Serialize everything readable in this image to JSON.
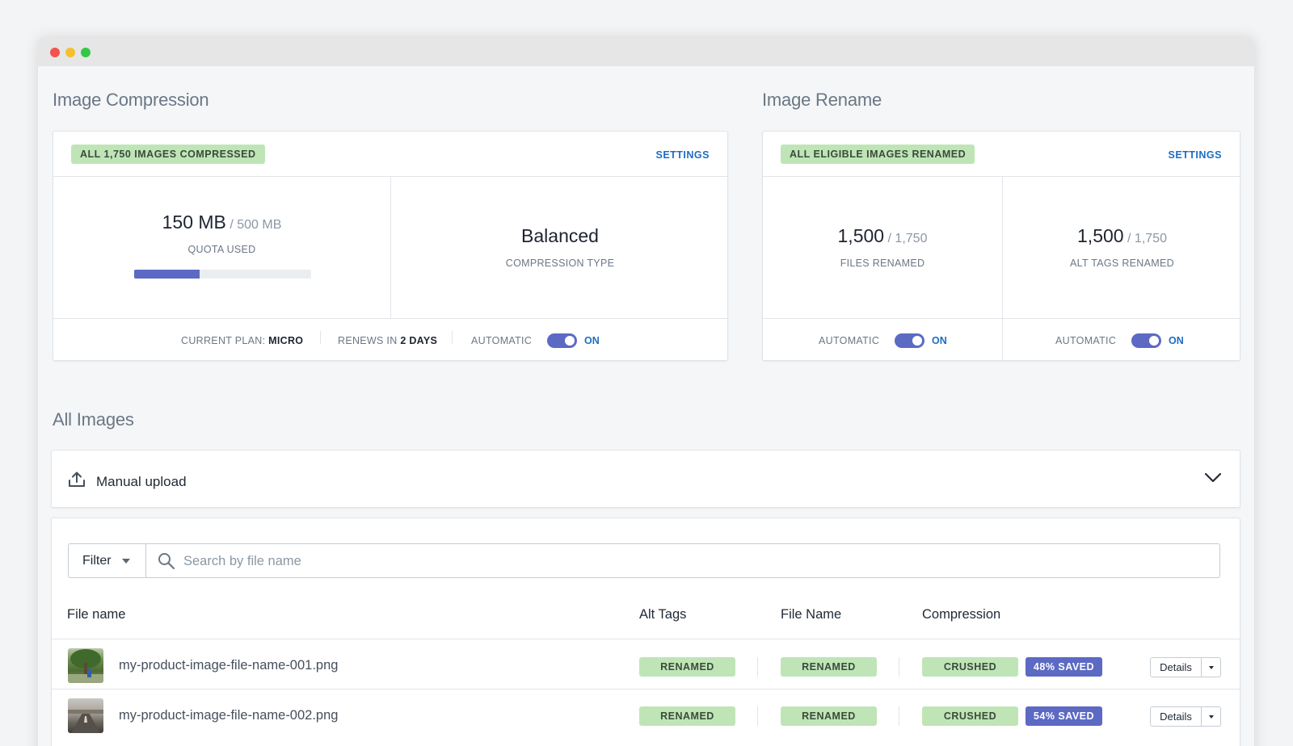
{
  "compression": {
    "section_title": "Image Compression",
    "status_badge": "ALL 1,750 IMAGES COMPRESSED",
    "settings_link": "SETTINGS",
    "quota_used": "150 MB",
    "quota_total": "/ 500 MB",
    "quota_label": "QUOTA USED",
    "quota_progress_percent": 37,
    "compression_type": "Balanced",
    "compression_type_label": "COMPRESSION TYPE",
    "plan_label": "CURRENT PLAN:",
    "plan_value": "MICRO",
    "renews_label": "RENEWS IN",
    "renews_value": "2 DAYS",
    "automatic_label": "AUTOMATIC",
    "automatic_state": "ON"
  },
  "rename": {
    "section_title": "Image Rename",
    "status_badge": "ALL ELIGIBLE IMAGES RENAMED",
    "settings_link": "SETTINGS",
    "files_renamed": "1,500",
    "files_total": "/ 1,750",
    "files_label": "FILES RENAMED",
    "alt_renamed": "1,500",
    "alt_total": "/ 1,750",
    "alt_label": "ALT TAGS RENAMED",
    "files_automatic_label": "AUTOMATIC",
    "files_automatic_state": "ON",
    "alt_automatic_label": "AUTOMATIC",
    "alt_automatic_state": "ON"
  },
  "all_images": {
    "section_title": "All Images",
    "upload_label": "Manual upload",
    "filter_label": "Filter",
    "search_placeholder": "Search by file name",
    "columns": {
      "file_name": "File name",
      "alt_tags": "Alt Tags",
      "file_name_status": "File Name",
      "compression": "Compression"
    },
    "rows": [
      {
        "file": "my-product-image-file-name-001.png",
        "alt_tags": "RENAMED",
        "file_name_status": "RENAMED",
        "compression": "CRUSHED",
        "saved": "48% SAVED",
        "details": "Details"
      },
      {
        "file": "my-product-image-file-name-002.png",
        "alt_tags": "RENAMED",
        "file_name_status": "RENAMED",
        "compression": "CRUSHED",
        "saved": "54% SAVED",
        "details": "Details"
      }
    ]
  },
  "colors": {
    "accent": "#5c6ac4",
    "badge_green": "#bfe5b7",
    "link_blue": "#1e6dc1"
  },
  "icons": [
    "upload-icon",
    "chevron-down-icon",
    "search-icon",
    "caret-down-icon"
  ]
}
